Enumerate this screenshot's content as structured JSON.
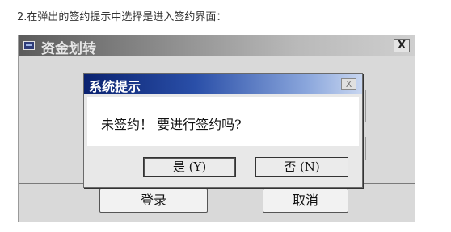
{
  "caption": "2.在弹出的签约提示中选择是进入签约界面：",
  "outer_window": {
    "title": "资金划转",
    "close_label": "X",
    "login_button": "登录",
    "cancel_button": "取消"
  },
  "dialog": {
    "title": "系统提示",
    "close_label": "X",
    "message": "未签约！ 要进行签约吗?",
    "yes_button": "是 (Y)",
    "no_button": "否 (N)"
  },
  "icons": {
    "window": "window-icon",
    "close": "close-icon"
  }
}
